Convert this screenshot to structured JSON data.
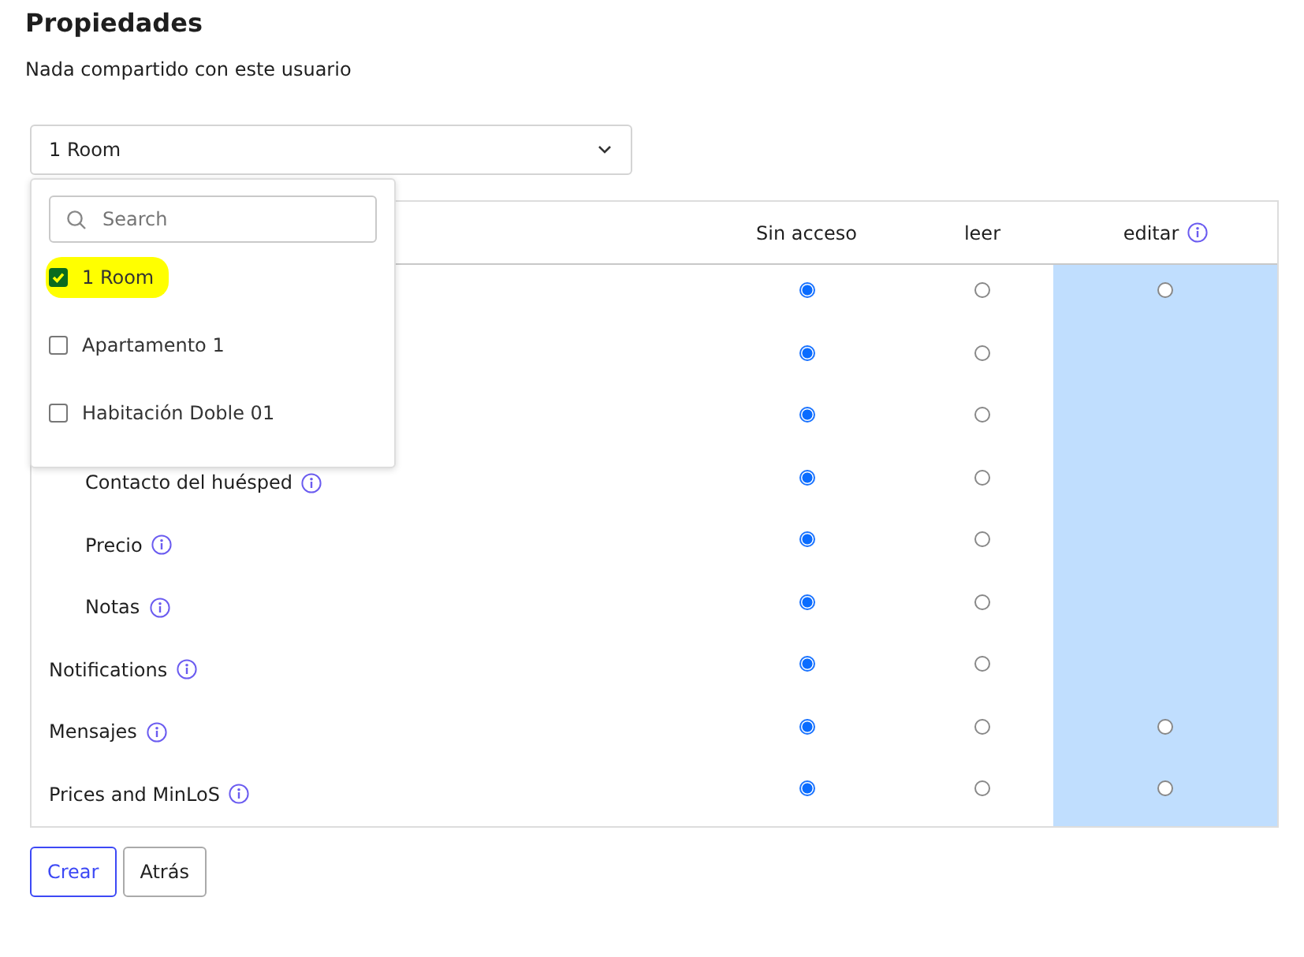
{
  "title": "Propiedades",
  "subtitle": "Nada compartido con este usuario",
  "property_select": {
    "value": "1 Room",
    "menu": {
      "search_placeholder": "Search",
      "options": [
        {
          "label": "1 Room",
          "checked": true,
          "highlighted": true
        },
        {
          "label": "Apartamento 1",
          "checked": false,
          "highlighted": false
        },
        {
          "label": "Habitación Doble 01",
          "checked": false,
          "highlighted": false
        }
      ]
    }
  },
  "table": {
    "columns": [
      {
        "label": "Sin acceso",
        "info": false
      },
      {
        "label": "leer",
        "info": false
      },
      {
        "label": "editar",
        "info": true
      }
    ],
    "rows": [
      {
        "choices": [
          {
            "selected": true
          },
          {
            "selected": false
          },
          {
            "selected": false
          }
        ]
      },
      {
        "choices": [
          {
            "selected": true
          },
          {
            "selected": false
          }
        ],
        "children": [
          {
            "choices": [
              {
                "selected": true
              },
              {
                "selected": false
              }
            ]
          },
          {
            "label": "Contacto del huésped",
            "info": true,
            "choices": [
              {
                "selected": true
              },
              {
                "selected": false
              }
            ]
          },
          {
            "label": "Precio",
            "info": true,
            "choices": [
              {
                "selected": true
              },
              {
                "selected": false
              }
            ]
          },
          {
            "label": "Notas",
            "info": true,
            "choices": [
              {
                "selected": true
              },
              {
                "selected": false
              }
            ]
          }
        ]
      },
      {
        "label": "Notifications",
        "info": true,
        "choices": [
          {
            "selected": true
          },
          {
            "selected": false
          }
        ]
      },
      {
        "label": "Mensajes",
        "info": true,
        "choices": [
          {
            "selected": true
          },
          {
            "selected": false
          },
          {
            "selected": false
          }
        ]
      },
      {
        "label": "Prices and MinLoS",
        "info": true,
        "choices": [
          {
            "selected": true
          },
          {
            "selected": false
          },
          {
            "selected": false
          }
        ]
      }
    ]
  },
  "buttons": [
    {
      "label": "Crear",
      "kind": "primary"
    },
    {
      "label": "Atrás",
      "kind": "secondary"
    }
  ]
}
